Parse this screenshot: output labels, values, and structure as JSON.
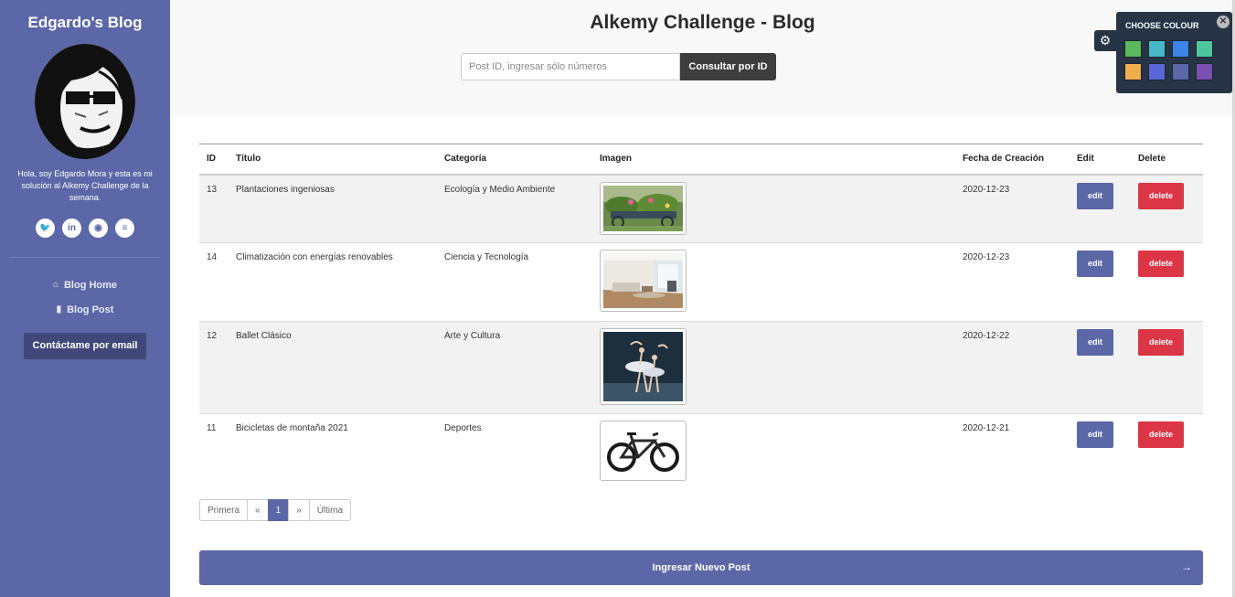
{
  "sidebar": {
    "title": "Edgardo's Blog",
    "bio": "Hola, soy Edgardo Mora y esta es mi solución al Alkemy Challenge de la semana.",
    "social": [
      {
        "icon": "twitter-icon",
        "glyph": "🐦"
      },
      {
        "icon": "linkedin-icon",
        "glyph": "in"
      },
      {
        "icon": "discord-icon",
        "glyph": "◉"
      },
      {
        "icon": "stackoverflow-icon",
        "glyph": "≡"
      }
    ],
    "nav": [
      {
        "icon": "home-icon",
        "glyph": "⌂",
        "label": "Blog Home"
      },
      {
        "icon": "bookmark-icon",
        "glyph": "▮",
        "label": "Blog Post"
      }
    ],
    "contact_label": "Contáctame por email"
  },
  "header": {
    "title": "Alkemy Challenge - Blog",
    "search_placeholder": "Post ID, ingresar sólo números",
    "search_button": "Consultar por ID"
  },
  "colour_panel": {
    "title": "CHOOSE COLOUR",
    "close": "✕",
    "gear": "⚙",
    "swatches": [
      "#5cb85c",
      "#46b8c8",
      "#3d84e6",
      "#4ec69b",
      "#f0ad4e",
      "#5b67d6",
      "#5b67a6",
      "#7a4fb0"
    ]
  },
  "table": {
    "headers": {
      "id": "ID",
      "title": "Título",
      "category": "Categoría",
      "image": "Imagen",
      "date": "Fecha de Creación",
      "edit": "Edit",
      "delete": "Delete"
    },
    "rows": [
      {
        "id": "13",
        "title": "Plantaciones ingeniosas",
        "category": "Ecología y Medio Ambiente",
        "date": "2020-12-23",
        "edit": "edit",
        "delete": "delete"
      },
      {
        "id": "14",
        "title": "Climatización con energías renovables",
        "category": "Ciencia y Tecnología",
        "date": "2020-12-23",
        "edit": "edit",
        "delete": "delete"
      },
      {
        "id": "12",
        "title": "Ballet Clásico",
        "category": "Arte y Cultura",
        "date": "2020-12-22",
        "edit": "edit",
        "delete": "delete"
      },
      {
        "id": "11",
        "title": "Bicicletas de montaña 2021",
        "category": "Deportes",
        "date": "2020-12-21",
        "edit": "edit",
        "delete": "delete"
      }
    ]
  },
  "pagination": {
    "first": "Primera",
    "prev": "«",
    "current": "1",
    "next": "»",
    "last": "Última"
  },
  "new_post": {
    "label": "Ingresar Nuevo Post",
    "arrow": "→"
  }
}
